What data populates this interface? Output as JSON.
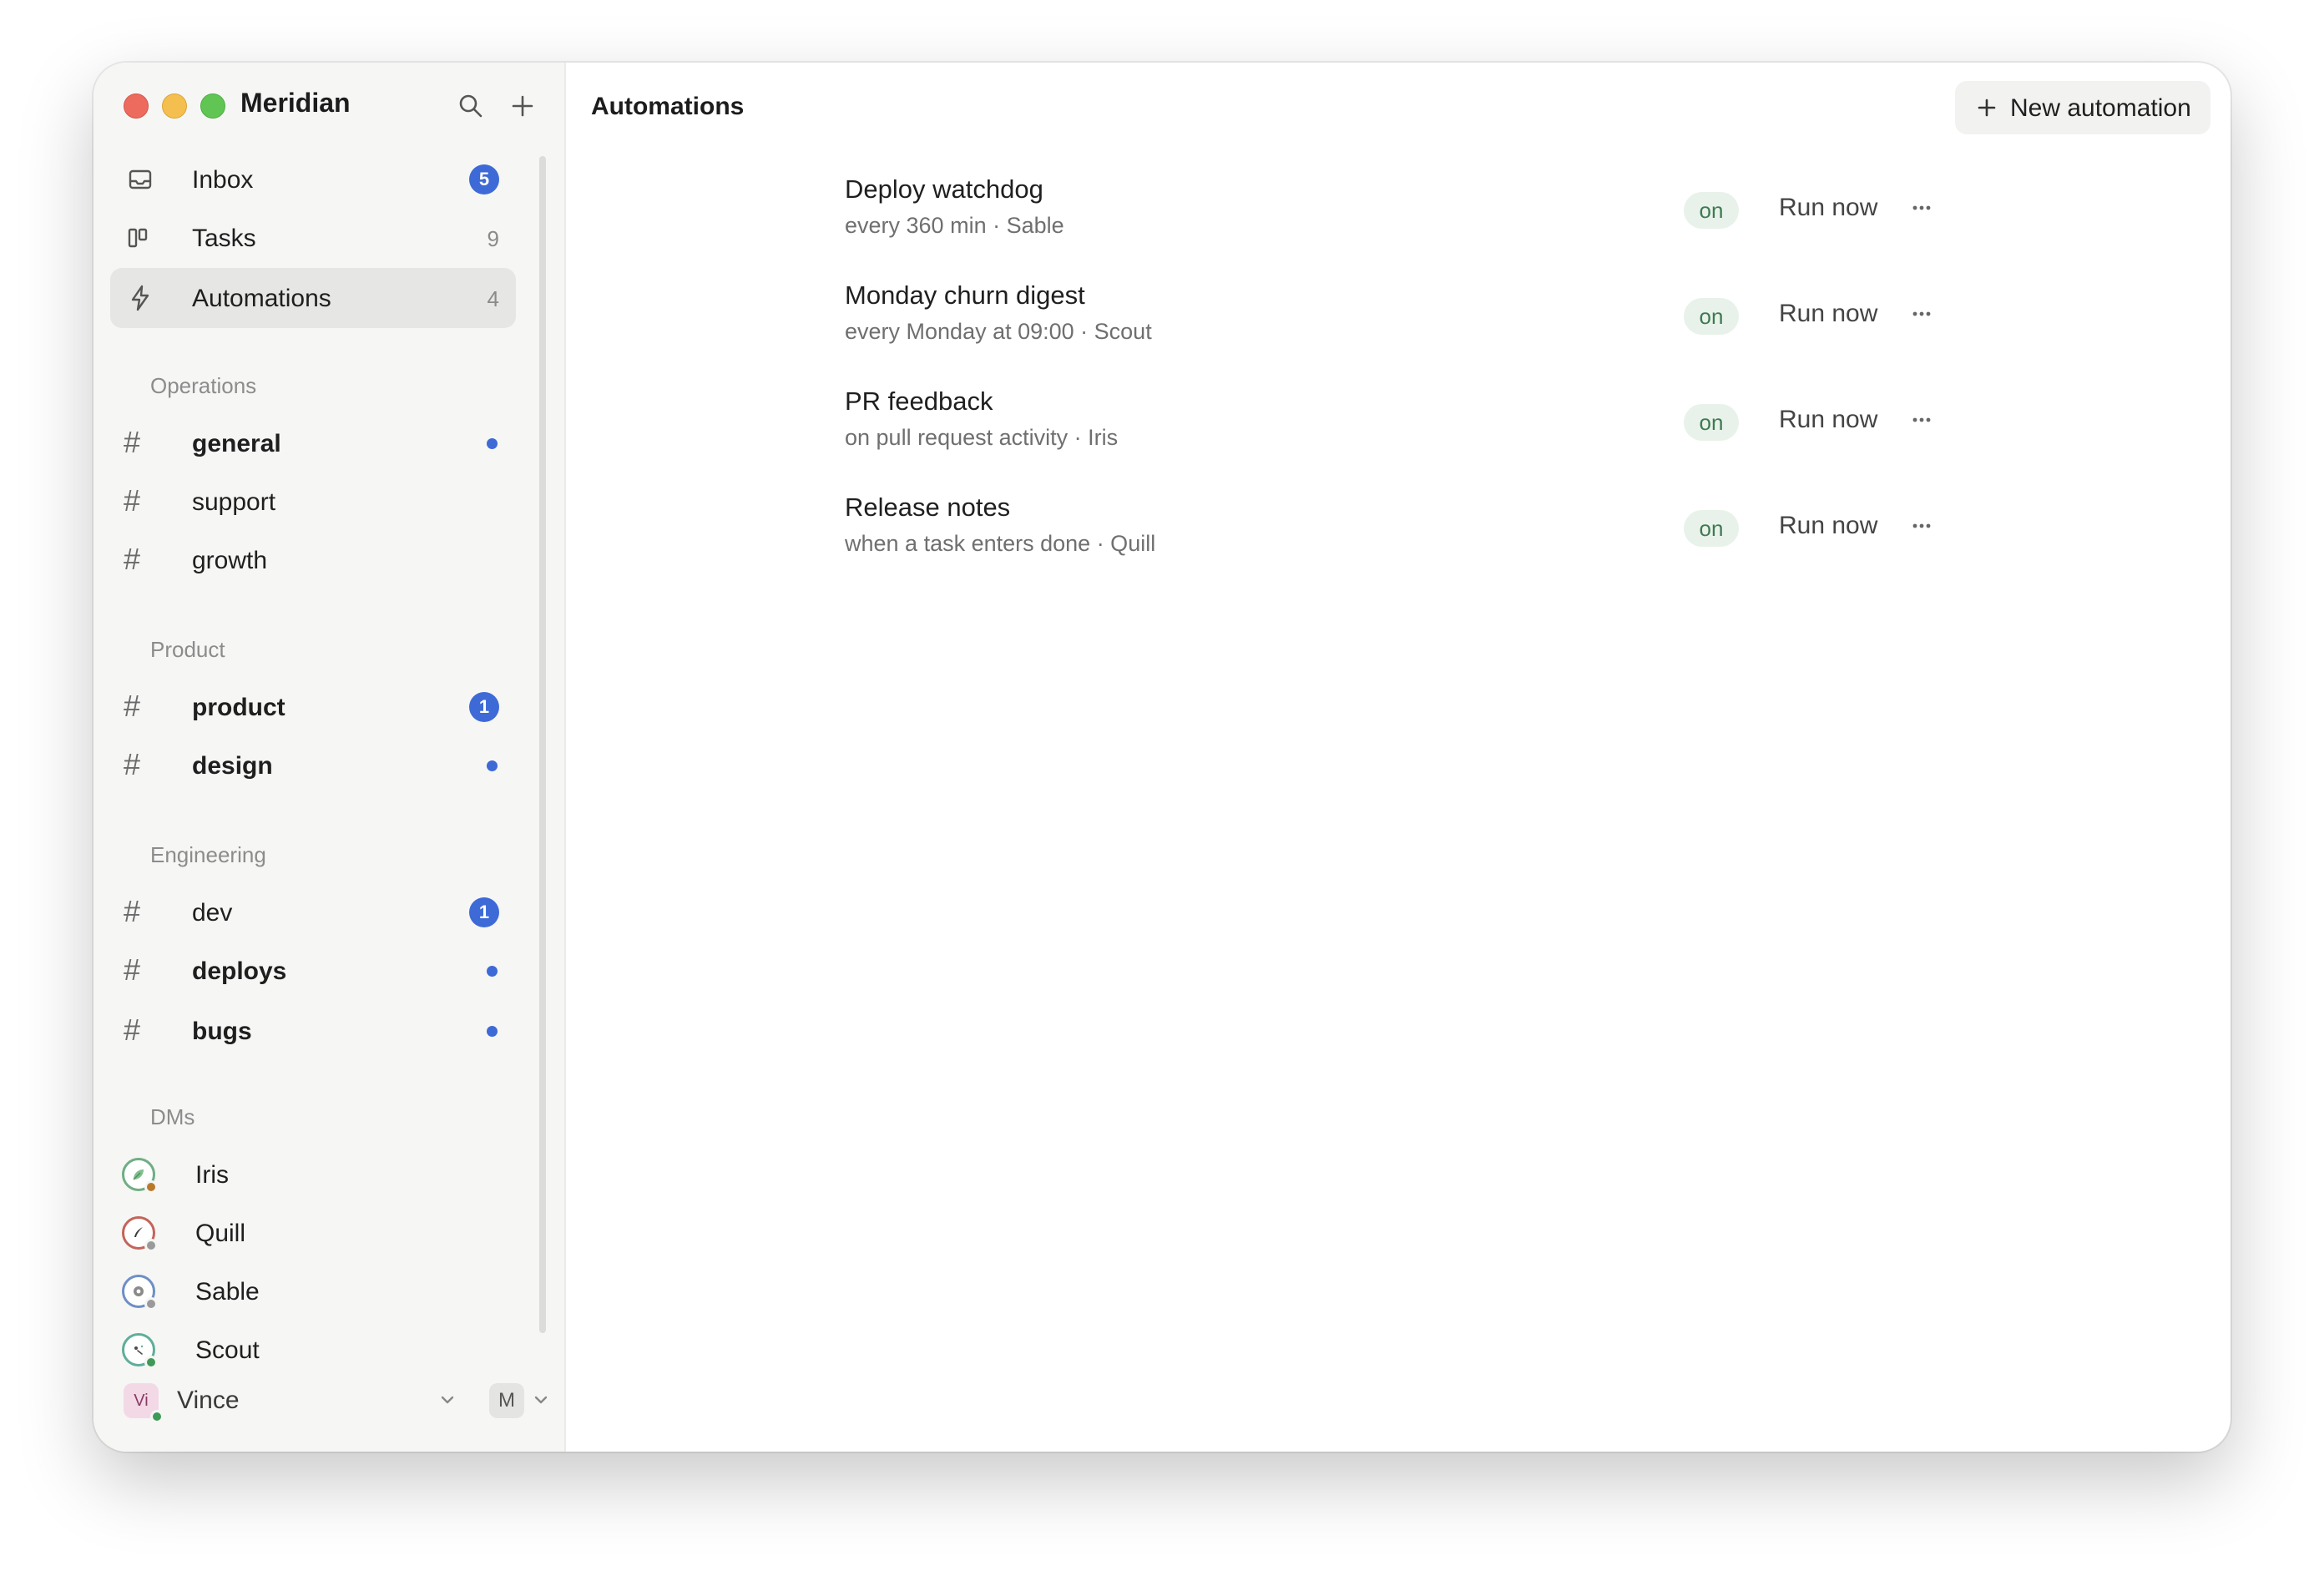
{
  "app": {
    "title": "Meridian"
  },
  "sidebar": {
    "primary": [
      {
        "label": "Inbox",
        "badge": "5",
        "icon": "inbox-icon"
      },
      {
        "label": "Tasks",
        "count": "9",
        "icon": "kanban-icon"
      },
      {
        "label": "Automations",
        "count": "4",
        "icon": "bolt-icon",
        "active": true
      }
    ],
    "sections": [
      {
        "label": "Operations",
        "channels": [
          {
            "name": "general",
            "bold": true,
            "unread_dot": true
          },
          {
            "name": "support",
            "bold": false
          },
          {
            "name": "growth",
            "bold": false
          }
        ]
      },
      {
        "label": "Product",
        "channels": [
          {
            "name": "product",
            "bold": true,
            "badge": "1"
          },
          {
            "name": "design",
            "bold": true,
            "unread_dot": true
          }
        ]
      },
      {
        "label": "Engineering",
        "channels": [
          {
            "name": "dev",
            "bold": false,
            "badge": "1"
          },
          {
            "name": "deploys",
            "bold": true,
            "unread_dot": true
          },
          {
            "name": "bugs",
            "bold": true,
            "unread_dot": true
          }
        ]
      }
    ],
    "dms_label": "DMs",
    "dms": [
      {
        "name": "Iris",
        "ring_color": "#6fae84",
        "presence_color": "#b87a2a",
        "icon": "leaf-icon"
      },
      {
        "name": "Quill",
        "ring_color": "#c4645a",
        "presence_color": "#9a9a9a",
        "icon": "quill-icon"
      },
      {
        "name": "Sable",
        "ring_color": "#6e8fc6",
        "presence_color": "#9a9a9a",
        "icon": "gear-icon"
      },
      {
        "name": "Scout",
        "ring_color": "#5fae9a",
        "presence_color": "#3f9a58",
        "icon": "compass-icon"
      }
    ],
    "user": {
      "initials": "Vi",
      "name": "Vince",
      "mode": "M"
    }
  },
  "main": {
    "title": "Automations",
    "new_button_label": "New automation",
    "automations": [
      {
        "title": "Deploy watchdog",
        "subtitle": "every 360 min · Sable",
        "status": "on",
        "action": "Run now"
      },
      {
        "title": "Monday churn digest",
        "subtitle": "every Monday at 09:00 · Scout",
        "status": "on",
        "action": "Run now"
      },
      {
        "title": "PR feedback",
        "subtitle": "on pull request activity · Iris",
        "status": "on",
        "action": "Run now"
      },
      {
        "title": "Release notes",
        "subtitle": "when a task enters done · Quill",
        "status": "on",
        "action": "Run now"
      }
    ]
  },
  "colors": {
    "accent": "#3d6ad6",
    "status_on_bg": "#e8f2ea",
    "status_on_text": "#3f7a52",
    "sidebar_bg": "#f6f6f5"
  }
}
